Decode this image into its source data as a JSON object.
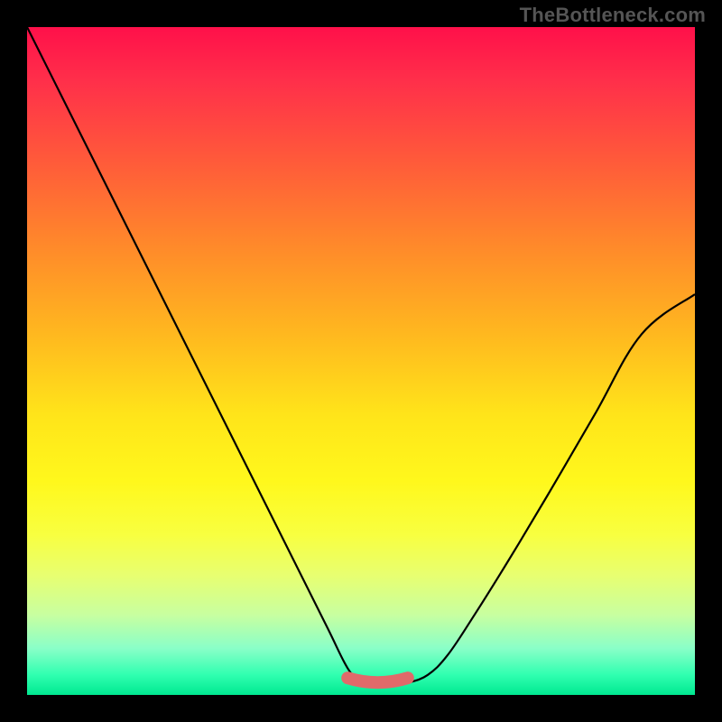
{
  "watermark": "TheBottleneck.com",
  "chart_data": {
    "type": "line",
    "title": "",
    "xlabel": "",
    "ylabel": "",
    "xlim": [
      0,
      100
    ],
    "ylim": [
      0,
      100
    ],
    "grid": false,
    "series": [
      {
        "name": "bottleneck-curve",
        "x": [
          0,
          5,
          10,
          15,
          20,
          25,
          30,
          35,
          40,
          45,
          48,
          50,
          52,
          55,
          57,
          60,
          63,
          67,
          72,
          78,
          85,
          92,
          100
        ],
        "values": [
          100,
          90,
          80,
          70,
          60,
          50,
          40,
          30,
          20,
          10,
          4,
          2,
          1.5,
          1.5,
          1.8,
          3,
          6,
          12,
          20,
          30,
          42,
          54,
          60
        ]
      }
    ],
    "annotations": [
      {
        "name": "flat-bottom-marker",
        "type": "segment",
        "color": "#e06a6a",
        "x_range": [
          48,
          57
        ],
        "y": 2,
        "thickness": 14
      }
    ],
    "background": {
      "type": "vertical-gradient",
      "stops": [
        {
          "pos": 0.0,
          "color": "#ff104a"
        },
        {
          "pos": 0.08,
          "color": "#ff2f4a"
        },
        {
          "pos": 0.2,
          "color": "#ff5a3a"
        },
        {
          "pos": 0.33,
          "color": "#ff8a2a"
        },
        {
          "pos": 0.46,
          "color": "#ffb81f"
        },
        {
          "pos": 0.58,
          "color": "#ffe41a"
        },
        {
          "pos": 0.68,
          "color": "#fff81c"
        },
        {
          "pos": 0.76,
          "color": "#f8ff40"
        },
        {
          "pos": 0.82,
          "color": "#e8ff70"
        },
        {
          "pos": 0.88,
          "color": "#c8ffa0"
        },
        {
          "pos": 0.93,
          "color": "#8affc8"
        },
        {
          "pos": 0.97,
          "color": "#30ffb0"
        },
        {
          "pos": 1.0,
          "color": "#00e890"
        }
      ]
    }
  }
}
